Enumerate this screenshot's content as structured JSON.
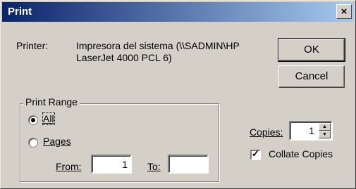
{
  "window": {
    "title": "Print",
    "close_glyph": "×"
  },
  "printer": {
    "label": "Printer:",
    "name_line1": "Impresora del sistema (\\\\SADMIN\\HP",
    "name_line2": "LaserJet 4000 PCL 6)"
  },
  "buttons": {
    "ok": "OK",
    "cancel": "Cancel"
  },
  "print_range": {
    "legend": "Print Range",
    "all_label": "All",
    "pages_label": "Pages",
    "from_label": "From:",
    "to_label": "To:",
    "from_value": "1",
    "to_value": "",
    "selected": "all"
  },
  "copies": {
    "label": "Copies:",
    "value": "1"
  },
  "collate": {
    "label": "Collate Copies",
    "checked": true
  }
}
